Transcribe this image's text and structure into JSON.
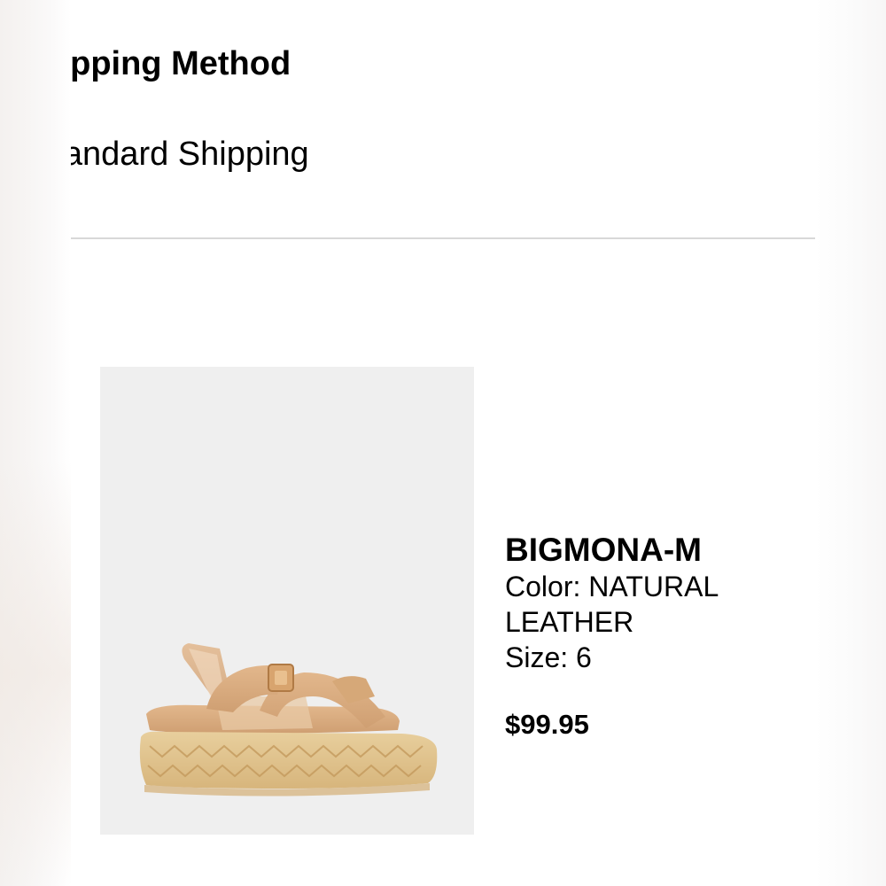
{
  "shipping": {
    "heading": "Shipping Method",
    "value": "Standard Shipping"
  },
  "product": {
    "name": "BIGMONA-M",
    "color_label": "Color: NATURAL",
    "color_label_cont": "LEATHER",
    "size_label": "Size: 6",
    "price": "$99.95",
    "image_icon": "sandal-product-image"
  },
  "colors": {
    "divider": "#d8d8d8",
    "image_bg": "#efefef",
    "text": "#000000"
  }
}
